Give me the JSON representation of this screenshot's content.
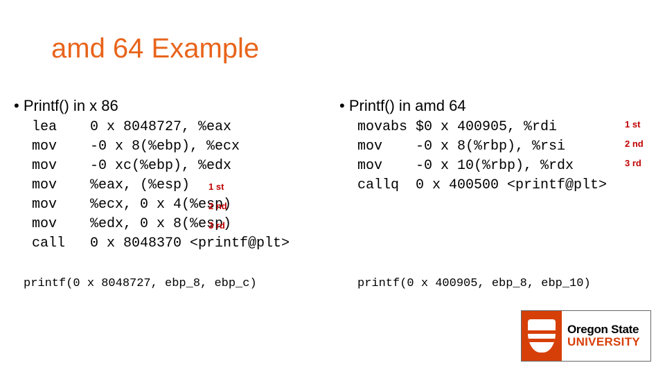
{
  "title": "amd 64 Example",
  "left_header": "• Printf() in x 86",
  "right_header": "• Printf() in amd 64",
  "left_code": "lea    0 x 8048727, %eax\nmov    -0 x 8(%ebp), %ecx\nmov    -0 xc(%ebp), %edx\nmov    %eax, (%esp)\nmov    %ecx, 0 x 4(%esp)\nmov    %edx, 0 x 8(%esp)\ncall   0 x 8048370 <printf@plt>",
  "right_code": "movabs $0 x 400905, %rdi\nmov    -0 x 8(%rbp), %rsi\nmov    -0 x 10(%rbp), %rdx\ncallq  0 x 400500 <printf@plt>",
  "ann": {
    "l1": "1 st",
    "l2": "2 nd",
    "l3": "3 rd",
    "r1": "1 st",
    "r2": "2 nd",
    "r3": "3 rd"
  },
  "left_summary": "printf(0 x 8048727, ebp_8, ebp_c)",
  "right_summary": "printf(0 x 400905, ebp_8, ebp_10)",
  "logo": {
    "line1": "Oregon State",
    "line2": "UNIVERSITY"
  }
}
